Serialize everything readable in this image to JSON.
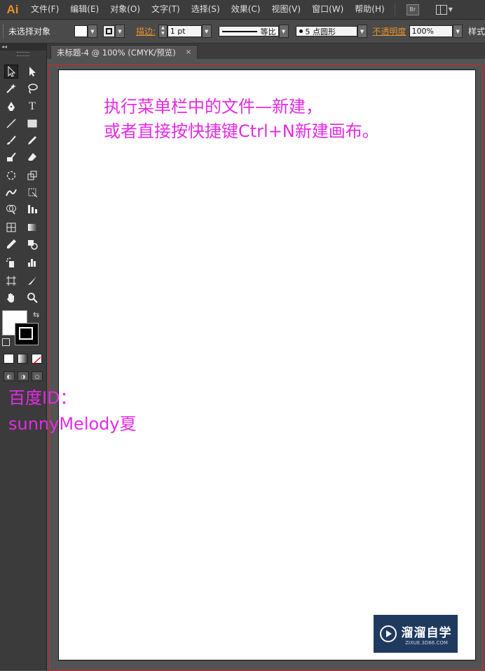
{
  "app": {
    "logo": "Ai"
  },
  "menu": [
    "文件(F)",
    "编辑(E)",
    "对象(O)",
    "文字(T)",
    "选择(S)",
    "效果(C)",
    "视图(V)",
    "窗口(W)",
    "帮助(H)"
  ],
  "menubar_right": {
    "bridge_label": "Br"
  },
  "control": {
    "selection": "未选择对象",
    "stroke_label": "描边:",
    "stroke_weight": "1 pt",
    "profile": "等比",
    "brush": "5 点圆形",
    "opacity_label": "不透明度",
    "opacity_value": "100%",
    "style_label": "样式"
  },
  "toolbox": {
    "collapse": "◂◂"
  },
  "document": {
    "tab_title": "未标题-4 @ 100% (CMYK/预览)",
    "tab_close": "×"
  },
  "caption": {
    "line1": "执行菜单栏中的文件—新建，",
    "line2": "或者直接按快捷键Ctrl+N新建画布。"
  },
  "watermark": {
    "line1": "百度ID：",
    "line2": "sunnyMelody夏"
  },
  "logo": {
    "name": "溜溜自学",
    "url": "ZIXUE.3D66.COM"
  },
  "colors": {
    "accent": "#e8912b",
    "caption": "#e42be4",
    "bleed": "#dd2222",
    "logo_bg": "#1f3a5f"
  }
}
